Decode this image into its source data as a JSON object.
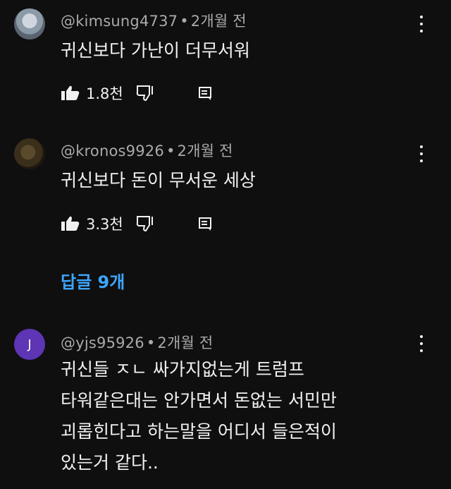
{
  "comments": [
    {
      "author": "@kimsung4737",
      "time": "2개월 전",
      "text_lines": [
        "귀신보다 가난이 더무서워"
      ],
      "likes": "1.8천"
    },
    {
      "author": "@kronos9926",
      "time": "2개월 전",
      "text_lines": [
        "귀신보다 돈이 무서운 세상"
      ],
      "likes": "3.3천"
    },
    {
      "author": "@yjs95926",
      "avatar_letter": "J",
      "time": "2개월 전",
      "text_lines": [
        "귀신들 ㅈㄴ 싸가지없는게 트럼프",
        "타워같은대는 안가면서 돈없는 서민만",
        "괴롭힌다고 하는말을 어디서 들은적이",
        "있는거 같다.."
      ]
    }
  ],
  "replies_link": "답글 9개",
  "separator": "•",
  "colors": {
    "link": "#3ea6ff",
    "meta": "#aaaaaa",
    "avatar_j": "#5d35b5"
  }
}
